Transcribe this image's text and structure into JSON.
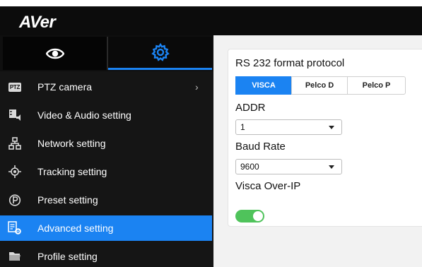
{
  "app": {
    "logo": "AVer"
  },
  "modes": {
    "preview": {
      "icon": "eye-icon"
    },
    "settings": {
      "icon": "gear-icon",
      "active": true
    }
  },
  "menu": {
    "items": [
      {
        "label": "PTZ camera",
        "icon": "ptz-icon",
        "badge": "PTZ",
        "chevron": "›"
      },
      {
        "label": "Video & Audio setting",
        "icon": "video-audio-icon"
      },
      {
        "label": "Network setting",
        "icon": "network-icon"
      },
      {
        "label": "Tracking setting",
        "icon": "tracking-icon"
      },
      {
        "label": "Preset setting",
        "icon": "preset-icon"
      },
      {
        "label": "Advanced setting",
        "icon": "advanced-settings-icon",
        "active": true
      },
      {
        "label": "Profile setting",
        "icon": "folder-icon"
      }
    ]
  },
  "panel": {
    "protocol_label": "RS 232 format protocol",
    "protocols": [
      "VISCA",
      "Pelco D",
      "Pelco P"
    ],
    "protocol_selected": "VISCA",
    "addr_label": "ADDR",
    "addr_value": "1",
    "baud_label": "Baud Rate",
    "baud_value": "9600",
    "visca_ip_label": "Visca Over-IP",
    "visca_ip_enabled": true
  },
  "colors": {
    "accent": "#1b83f2",
    "toggle_on": "#4fc35b",
    "sidebar_bg": "#151515",
    "header_bg": "#0c0c0c"
  }
}
